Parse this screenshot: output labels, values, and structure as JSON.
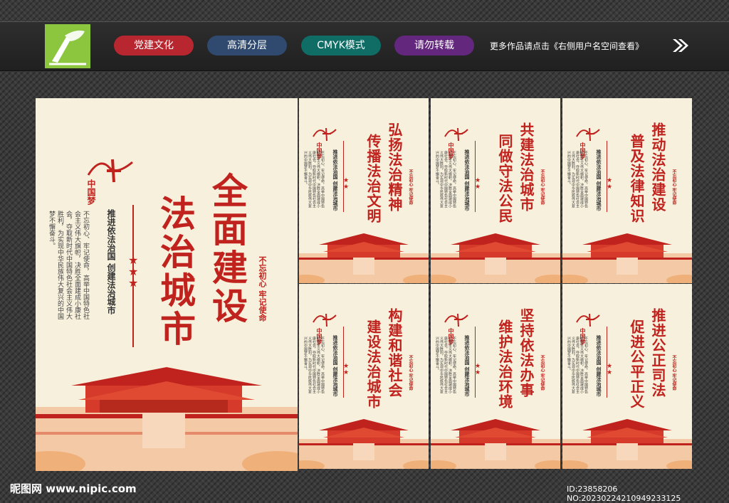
{
  "header": {
    "tags": [
      {
        "label": "党建文化",
        "color": "#b8262f"
      },
      {
        "label": "高清分层",
        "color": "#2f4a6e"
      },
      {
        "label": "CMYK模式",
        "color": "#0f6d66"
      },
      {
        "label": "请勿转载",
        "color": "#63287e"
      }
    ],
    "more_text": "更多作品请点击《右侧用户名空间查看》",
    "more_arrow_icon": "double-chevron-right-icon"
  },
  "main_poster": {
    "brand": "中国梦",
    "title_line1": "全面建设",
    "title_line2": "法治城市",
    "seal_text": "不忘初心 牢记使命",
    "subtitle": "推进依法治国  创建法治城市",
    "body": "不忘初心、牢记使命，高举中国特色社会主义伟大旗帜，决胜全面建成小康社会，夺取新时代中国特色社会主义伟大胜利，为实现中华民族伟大复兴的中国梦不懈奋斗。"
  },
  "small_posters": [
    {
      "line1": "弘扬法治精神",
      "line2": "传播法治文明"
    },
    {
      "line1": "共建法治城市",
      "line2": "同做守法公民"
    },
    {
      "line1": "推动法治建设",
      "line2": "普及法律知识"
    },
    {
      "line1": "构建和谐社会",
      "line2": "建设法治城市"
    },
    {
      "line1": "坚持依法办事",
      "line2": "维护法治环境"
    },
    {
      "line1": "推进公正司法",
      "line2": "促进公平正义"
    }
  ],
  "small_common": {
    "brand": "中国梦",
    "subtitle": "推进依法治国  创建法治城市",
    "seal_text": "不忘初心 牢记使命",
    "body": "不忘初心、牢记使命，高举中国特色社会主义伟大旗帜，决胜全面建成小康社会，夺取新时代中国特色社会主义伟大胜利，为实现中华民族伟大复兴的中国梦不懈奋斗。"
  },
  "footer": {
    "site": "昵图网 www.nipic.com",
    "id_text": "ID:23858206 NO:20230224210949233125"
  }
}
